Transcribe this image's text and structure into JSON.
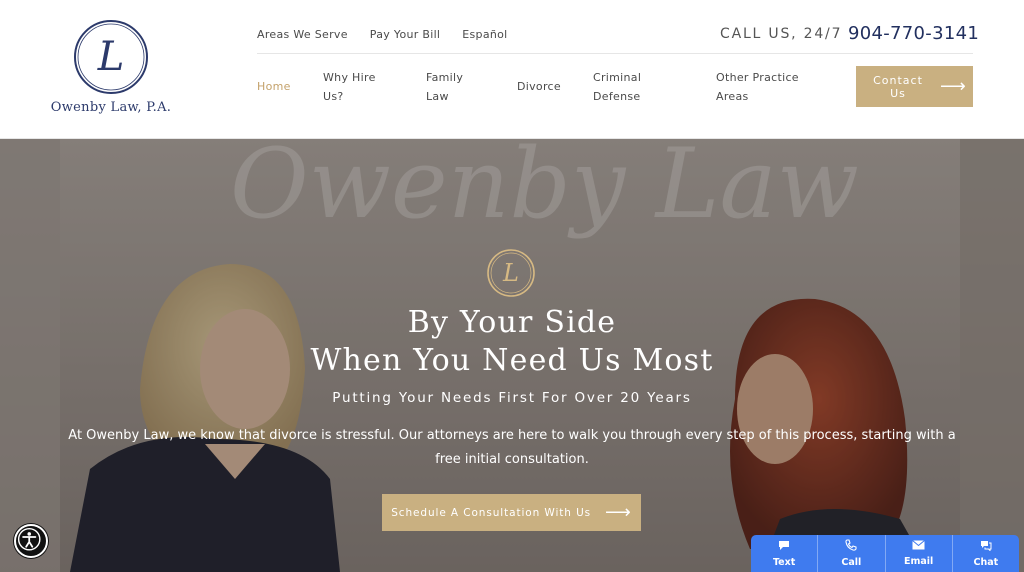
{
  "brand": {
    "name": "Owenby Law, P.A.",
    "monogram": "L"
  },
  "utility_nav": [
    "Areas We Serve",
    "Pay Your Bill",
    "Español"
  ],
  "call": {
    "label": "CALL US, 24/7",
    "phone": "904-770-3141"
  },
  "main_nav": [
    {
      "line1": "Home",
      "line2": ""
    },
    {
      "line1": "Why Hire",
      "line2": "Us?"
    },
    {
      "line1": "Family",
      "line2": "Law"
    },
    {
      "line1": "Divorce",
      "line2": ""
    },
    {
      "line1": "Criminal",
      "line2": "Defense"
    },
    {
      "line1": "Other Practice",
      "line2": "Areas"
    }
  ],
  "cta": {
    "line1": "Contact",
    "line2": "Us",
    "arrow": "⟶"
  },
  "hero": {
    "bg_sign_text": "Owenby Law",
    "title_line1": "By Your Side",
    "title_line2": "When You Need Us Most",
    "subtitle": "Putting Your Needs First For Over 20 Years",
    "paragraph": "At Owenby Law, we know that divorce is stressful. Our attorneys are here to walk you through every step of this process, starting with a free initial consultation.",
    "button": "Schedule A Consultation With Us",
    "button_arrow": "⟶"
  },
  "contact_bar": [
    {
      "label": "Text",
      "icon": "chat-bubble-icon"
    },
    {
      "label": "Call",
      "icon": "phone-icon"
    },
    {
      "label": "Email",
      "icon": "envelope-icon"
    },
    {
      "label": "Chat",
      "icon": "chat-icon"
    }
  ],
  "colors": {
    "navy": "#22305f",
    "gold": "#c9b081",
    "blue_bar": "#3f7bef"
  }
}
